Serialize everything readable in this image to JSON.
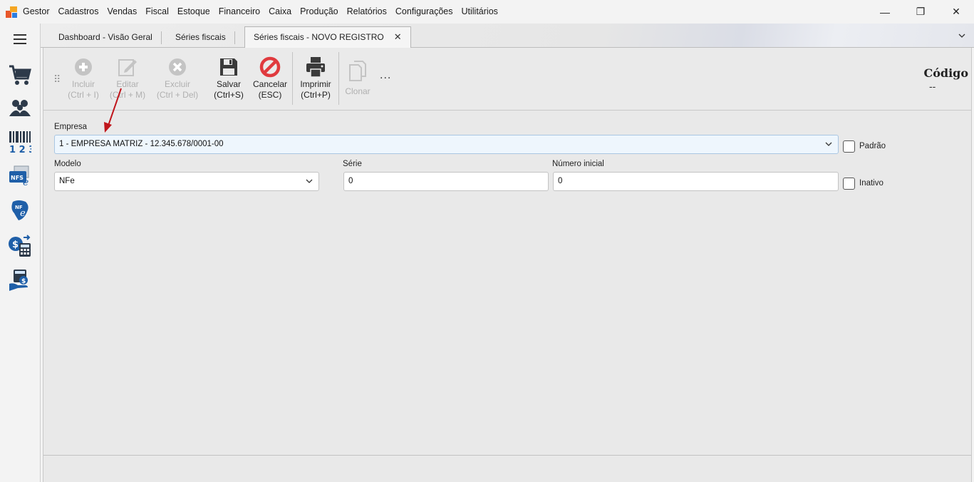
{
  "menubar": {
    "app_name": "Gestor",
    "items": [
      "Cadastros",
      "Vendas",
      "Fiscal",
      "Estoque",
      "Financeiro",
      "Caixa",
      "Produção",
      "Relatórios",
      "Configurações",
      "Utilitários"
    ]
  },
  "window_controls": {
    "minimize": "—",
    "restore": "❐",
    "close": "✕"
  },
  "sidebar": {
    "icons": [
      "menu-icon",
      "cart-icon",
      "users-icon",
      "barcode-icon",
      "nfse-icon",
      "nfe-icon",
      "money-calculator-icon",
      "cash-register-icon"
    ]
  },
  "tabs": [
    {
      "label": "Dashboard - Visão Geral",
      "active": false
    },
    {
      "label": "Séries fiscais",
      "active": false
    },
    {
      "label": "Séries fiscais - NOVO REGISTRO",
      "active": true
    }
  ],
  "tab_close": "✕",
  "toolbar": {
    "buttons": [
      {
        "label": "Incluir",
        "shortcut": "(Ctrl + I)",
        "icon": "plus-circle-icon",
        "enabled": false
      },
      {
        "label": "Editar",
        "shortcut": "(Ctrl + M)",
        "icon": "edit-icon",
        "enabled": false
      },
      {
        "label": "Excluir",
        "shortcut": "(Ctrl + Del)",
        "icon": "x-circle-icon",
        "enabled": false
      },
      {
        "label": "Salvar",
        "shortcut": "(Ctrl+S)",
        "icon": "save-icon",
        "enabled": true
      },
      {
        "label": "Cancelar",
        "shortcut": "(ESC)",
        "icon": "cancel-icon",
        "enabled": true
      },
      {
        "label": "Imprimir",
        "shortcut": "(Ctrl+P)",
        "icon": "print-icon",
        "enabled": true
      },
      {
        "label": "Clonar",
        "shortcut": "",
        "icon": "clone-icon",
        "enabled": false
      }
    ],
    "more": "...",
    "codigo_label": "Código",
    "codigo_value": "--"
  },
  "form": {
    "empresa_label": "Empresa",
    "empresa_value": "1 - EMPRESA MATRIZ - 12.345.678/0001-00",
    "padrao_label": "Padrão",
    "modelo_label": "Modelo",
    "modelo_value": "NFe",
    "serie_label": "Série",
    "serie_value": "0",
    "numero_label": "Número inicial",
    "numero_value": "0",
    "inativo_label": "Inativo"
  },
  "colors": {
    "cancel_red": "#e03a3e",
    "annotation_arrow": "#c0161c",
    "sidebar_blue": "#1f5fa8"
  }
}
